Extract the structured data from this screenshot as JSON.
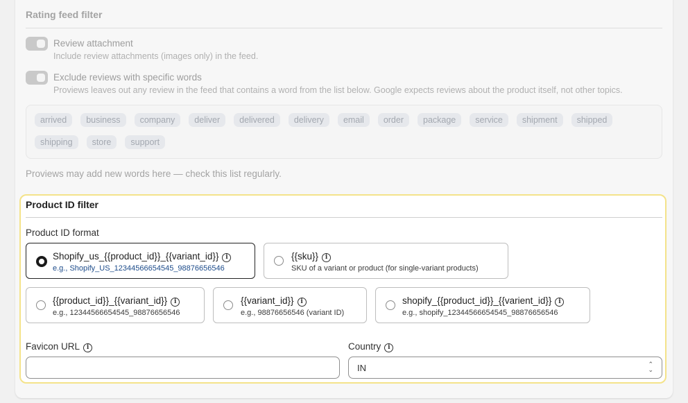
{
  "rating_filter": {
    "title": "Rating feed filter",
    "review_attachment": {
      "label": "Review attachment",
      "help": "Include review attachments (images only) in the feed."
    },
    "exclude_words": {
      "label": "Exclude reviews with specific words",
      "help": "Proviews leaves out any review in the feed that contains a word from the list below. Google expects reviews about the product itself, not other topics."
    },
    "words": [
      "arrived",
      "business",
      "company",
      "deliver",
      "delivered",
      "delivery",
      "email",
      "order",
      "package",
      "service",
      "shipment",
      "shipped",
      "shipping",
      "store",
      "support"
    ],
    "note": "Proviews may add new words here — check this list regularly."
  },
  "product_id_filter": {
    "title": "Product ID filter",
    "format_label": "Product ID format",
    "options": [
      {
        "title": "Shopify_us_{{product_id}}_{{variant_id}}",
        "example": "e.g., Shopify_US_12344566654545_98876656546",
        "selected": true
      },
      {
        "title": "{{sku}}",
        "example": "SKU of a variant or product (for single-variant products)",
        "selected": false
      },
      {
        "title": "{{product_id}}_{{variant_id}}",
        "example": "e.g., 12344566654545_98876656546",
        "selected": false
      },
      {
        "title": "{{variant_id}}",
        "example": "e.g., 98876656546 (variant ID)",
        "selected": false
      },
      {
        "title": "shopify_{{product_id}}_{{varient_id}}",
        "example": "e.g., shopify_12344566654545_98876656546",
        "selected": false
      }
    ],
    "favicon": {
      "label": "Favicon URL",
      "value": "",
      "placeholder": ""
    },
    "country": {
      "label": "Country",
      "value": "IN"
    }
  },
  "icons": {
    "info": "info-circle-icon",
    "select": "chevron-up-down-icon"
  }
}
